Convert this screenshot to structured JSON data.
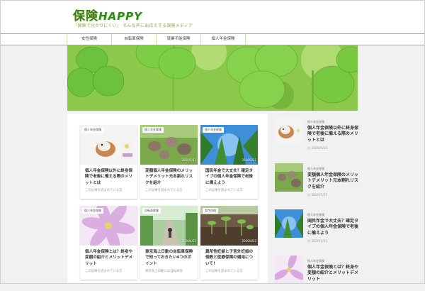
{
  "site": {
    "logo_main": "保険",
    "logo_latin": "HAPPY",
    "tagline": "「保険で分かりにくい」 そんな声にお応えする保険メディア"
  },
  "nav": [
    {
      "label": "女性保険"
    },
    {
      "label": "自転車保険"
    },
    {
      "label": "就業不能保険"
    },
    {
      "label": "個人年金保険"
    }
  ],
  "cards": [
    {
      "tag": "個人年金保険",
      "date": "",
      "title": "個人年金保険以外に終身保険で老後に備える際のメリットとは",
      "snippet": "この記事を読まれている方"
    },
    {
      "tag": "個人年金保険",
      "date": "2020/5/21",
      "title": "変額個人年金保険のメリットデメリット元本割れリスクを紹介",
      "snippet": "この記事を読まれている方"
    },
    {
      "tag": "個人年金保険",
      "date": "2020/5/21",
      "title": "国民年金で大丈夫？確定タイプの個人年金保険で老後に備えよう",
      "snippet": "この記事を読まれている方"
    },
    {
      "tag": "個人年金保険",
      "date": "",
      "title": "個人年金保険とは？終身や変額の紹介とメリットデメリット",
      "snippet": "この記事を読まれている方"
    },
    {
      "tag": "自転車保険",
      "date": "2020/4/22",
      "title": "東京海上日動の自転車保険で知っておきたい4つのポイント",
      "snippet": "東京海上日動には自転車保"
    },
    {
      "tag": "女性保険",
      "date": "2020/4/22",
      "title": "異所性妊娠と子宮外妊娠の個数と医療保険の適用について！",
      "snippet": "この記事を読まれている方"
    }
  ],
  "sidebar": [
    {
      "tag": "個人年金保険",
      "title": "個人年金保険以外に終身保険で老後に備える際のメリットとは",
      "date": "2020/5/21"
    },
    {
      "tag": "個人年金保険",
      "title": "変額個人年金保険のメリットデメリット元本割れリスクを紹介",
      "date": "2020/5/21"
    },
    {
      "tag": "個人年金保険",
      "title": "国民年金で大丈夫？確定タイプの個人年金保険で老後に備えよう",
      "date": "2020/5/21"
    },
    {
      "tag": "個人年金保険",
      "title": "個人年金保険とは？終身や変額の紹介とメリットデメリット",
      "date": ""
    }
  ],
  "icons": [
    "clock-icon"
  ],
  "colors": {
    "accent": "#8cc63e",
    "logo": "#3f7a1a"
  }
}
